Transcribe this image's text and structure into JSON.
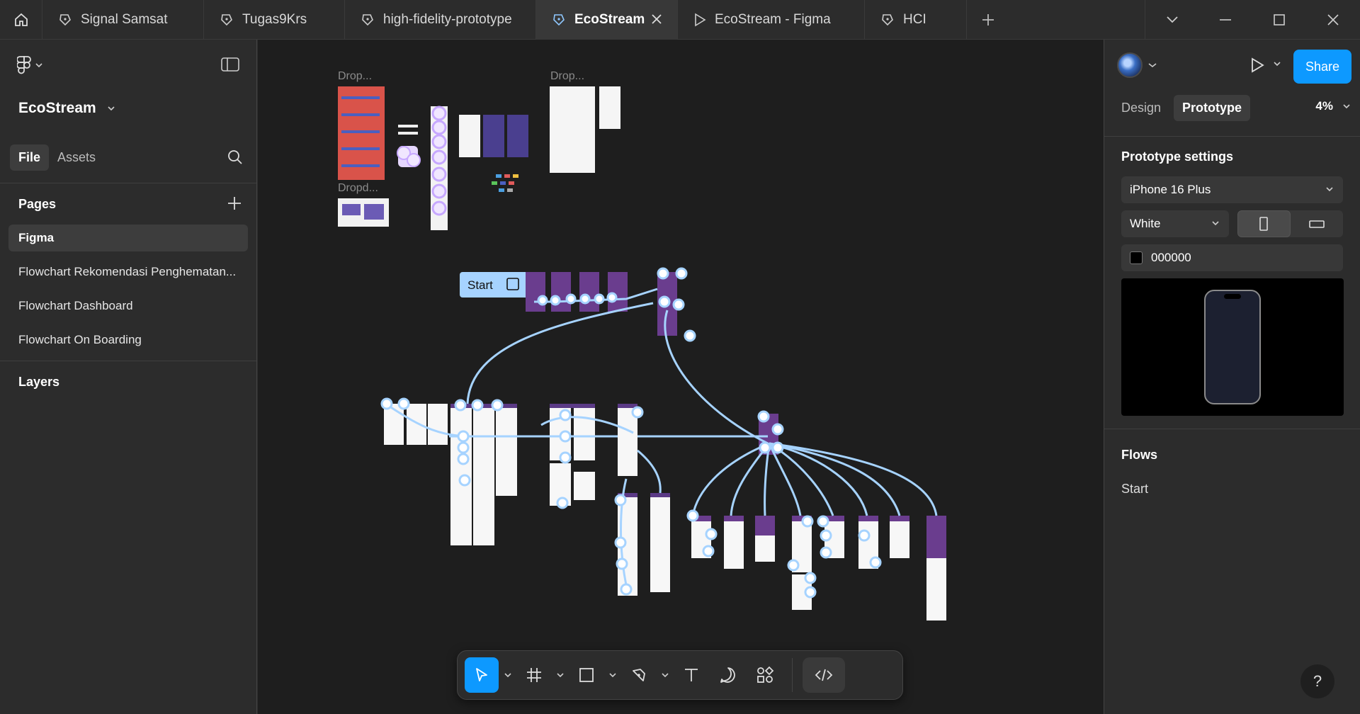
{
  "tabs": [
    {
      "title": "Signal Samsat",
      "icon": "figma-file-icon"
    },
    {
      "title": "Tugas9Krs",
      "icon": "figma-file-icon"
    },
    {
      "title": "high-fidelity-prototype",
      "icon": "figma-file-icon"
    },
    {
      "title": "EcoStream",
      "icon": "figma-file-icon",
      "active": true
    },
    {
      "title": "EcoStream - Figma",
      "icon": "play-icon"
    },
    {
      "title": "HCI",
      "icon": "figma-file-icon"
    }
  ],
  "left_panel": {
    "file_title": "EcoStream",
    "tab_file": "File",
    "tab_assets": "Assets",
    "pages_header": "Pages",
    "pages": [
      {
        "label": "Figma",
        "active": true
      },
      {
        "label": "Flowchart Rekomendasi Penghematan..."
      },
      {
        "label": "Flowchart Dashboard"
      },
      {
        "label": "Flowchart On Boarding"
      }
    ],
    "layers_header": "Layers"
  },
  "canvas": {
    "labels": {
      "drop1": "Drop...",
      "drop2": "Dropd...",
      "drop3": "Drop...",
      "start_flow": "Start"
    }
  },
  "right_panel": {
    "share_label": "Share",
    "tab_design": "Design",
    "tab_prototype": "Prototype",
    "zoom": "4%",
    "settings_title": "Prototype settings",
    "device": "iPhone 16 Plus",
    "device_color": "White",
    "background_hex": "000000",
    "flows_title": "Flows",
    "flow_name": "Start",
    "help": "?"
  },
  "colors": {
    "accent": "#0d99ff",
    "connector": "#a6d3ff",
    "canvas_bg": "#1e1e1e",
    "panel_bg": "#2c2c2c",
    "frame_purple": "#5b3a86",
    "frame_red": "#d9534a"
  }
}
